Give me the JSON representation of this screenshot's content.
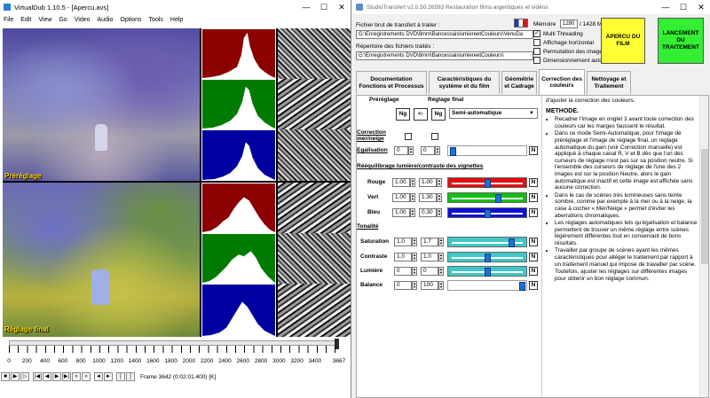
{
  "virtualdub": {
    "title": "VirtualDub 1.10.5 - [Apercu.avs]",
    "menu": [
      "File",
      "Edit",
      "View",
      "Go",
      "Video",
      "Audio",
      "Options",
      "Tools",
      "Help"
    ],
    "label_top": "Préréglage",
    "label_bottom": "Réglage final",
    "ruler_ticks": [
      "0",
      "200",
      "400",
      "600",
      "800",
      "1000",
      "1200",
      "1400",
      "1600",
      "1800",
      "2000",
      "2200",
      "2400",
      "2600",
      "2800",
      "3000",
      "3200",
      "3400",
      "3667"
    ],
    "frame_status": "Frame 3642 (0:02:01.400) [K]",
    "position_frame": 3642,
    "total_frames": 3667
  },
  "studio": {
    "title": "StudioTransfert v2.0.50.26593 Restauration films argentiques et vidéos",
    "source_label": "Fichier brut de transfert à traiter :",
    "source_path": "G:\\Enregistrements DVD\\8mm\\BancessaislumiereetCouleurs\\VenuDa",
    "dest_label": "Répertoire des fichiers traités :",
    "dest_path": "G:\\Enregistrements DVD\\8mm\\BancessaislumiereetCouleurs\\",
    "memory_label": "Mémoire",
    "memory_value": "1280",
    "memory_total": "/ 1428 Mo",
    "options": [
      {
        "label": "Multi Threading",
        "checked": true
      },
      {
        "label": "Affichage horizontal",
        "checked": false
      },
      {
        "label": "Permutation des images",
        "checked": false
      },
      {
        "label": "Dimensionnement auto",
        "checked": false
      }
    ],
    "preview_button": "APERCU DU FILM",
    "launch_button": "LANCEMENT DU TRAITEMENT",
    "tabs": [
      "Documentation Fonctions et Processus",
      "Caractéristiques du système et du film",
      "Géométrie et Cadrage",
      "Correction des couleurs",
      "Nettoyage et Traitement"
    ],
    "panel": {
      "prereglage": "Préréglage",
      "reglage_final": "Réglage final",
      "ng1": "Ng",
      "arrow": "<-",
      "ng2": "Ng",
      "mode": "Semi-automatique",
      "correction_label": "Correction mer/neige",
      "egalisation_label": "Egalisation",
      "egalisation_pre": "0",
      "egalisation_fin": "0",
      "rebalance_title": "Rééquilibrage lumière/contraste des vignettes",
      "rouge_label": "Rouge",
      "rouge_pre": "1.00",
      "rouge_fin": "1.00",
      "vert_label": "Vert",
      "vert_pre": "1.00",
      "vert_fin": "1.30",
      "bleu_label": "Bleu",
      "bleu_pre": "1.00",
      "bleu_fin": "0.30",
      "tonalite_title": "Tonalité",
      "saturation_label": "Saturation",
      "saturation_pre": "1.0",
      "saturation_fin": "1.7",
      "contraste_label": "Contraste",
      "contraste_pre": "1.0",
      "contraste_fin": "1.0",
      "lumiere_label": "Lumière",
      "lumiere_pre": "0",
      "lumiere_fin": "0",
      "balance_label": "Balance",
      "balance_pre": "0",
      "balance_fin": "100",
      "n": "N"
    },
    "help": {
      "intro": "d'ajuster la correction des couleurs.",
      "method": "METHODE.",
      "items": [
        "Recadrer l'image en onglet 3 avant toute correction des couleurs car les marges faussent le résultat.",
        "Dans ce mode Semi-Automatique, pour l'image de préréglage et l'image de réglage final, un réglage automatique du gain (voir Correction manuelle) est appliqué à chaque canal R, V et B dès que l'un des curseurs de réglage n'est pas sur sa position neutre. Si l'ensemble des curseurs de réglage de l'une des 2 images est sur la position Neutre, alors le gain automatique est inactif et cette image est affichée sans aucune correction.",
        "Dans le cas de scènes très lumineuses sans teinte sombre, comme par exemple à la mer ou à la neige, la case à cocher « Mer/Neige » permet d'éviter les aberrations chromatiques.",
        "Les réglages automatiques tels qu'égalisation et balance permettent de trouver un même réglage entre scènes légèrement différentes tout en conservant de bons résultats.",
        "Travailler par groupe de scènes ayant les mêmes caractéristiques pour alléger le traitement par rapport à un traitement manuel qui impose de travailler par scène."
      ],
      "tail": "Toutefois, ajuster les réglages sur différentes images pour obtenir un bon réglage commun."
    }
  },
  "colors": {
    "rouge": "#e01010",
    "vert": "#10c010",
    "bleu": "#1010d0",
    "tonalite": "#40c8c8",
    "preview_btn": "#ffff33",
    "launch_btn": "#33ee33"
  }
}
